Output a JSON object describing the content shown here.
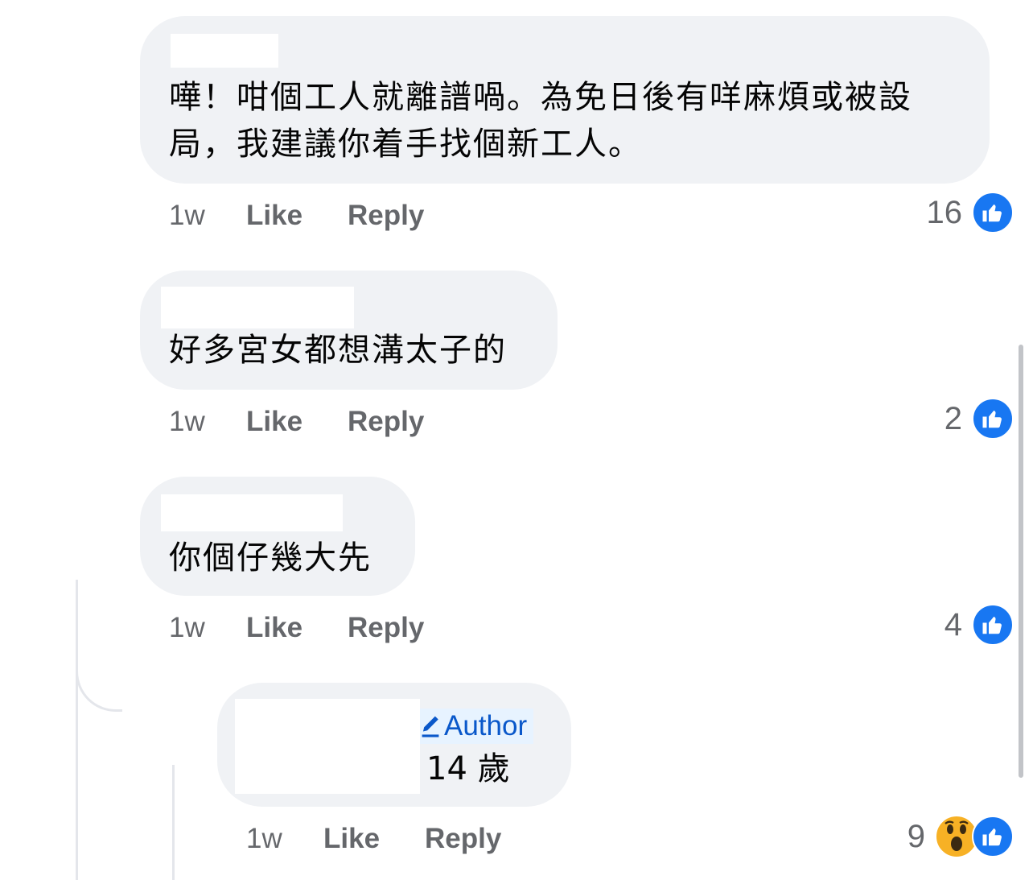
{
  "comments": [
    {
      "text": "嘩！咁個工人就離譜喎。為免日後有咩麻煩或被設\n局，我建議你着手找個新工人。",
      "time": "1w",
      "like": "Like",
      "reply": "Reply",
      "reaction_count": "16"
    },
    {
      "text": "好多宮女都想溝太子的",
      "time": "1w",
      "like": "Like",
      "reply": "Reply",
      "reaction_count": "2"
    },
    {
      "text": "你個仔幾大先",
      "time": "1w",
      "like": "Like",
      "reply": "Reply",
      "reaction_count": "4"
    }
  ],
  "reply_comment": {
    "author_badge": "Author",
    "text": "14 歲",
    "time": "1w",
    "like": "Like",
    "reply": "Reply",
    "reaction_count": "9"
  },
  "colors": {
    "bubble": "#f0f2f5",
    "meta": "#65676b",
    "like_blue": "#1877f2",
    "author_blue": "#0a58ca",
    "author_badge_bg": "#e7f3ff"
  },
  "icons": {
    "like": "like-reaction-icon",
    "wow": "wow-reaction-icon",
    "author": "pencil-icon"
  }
}
